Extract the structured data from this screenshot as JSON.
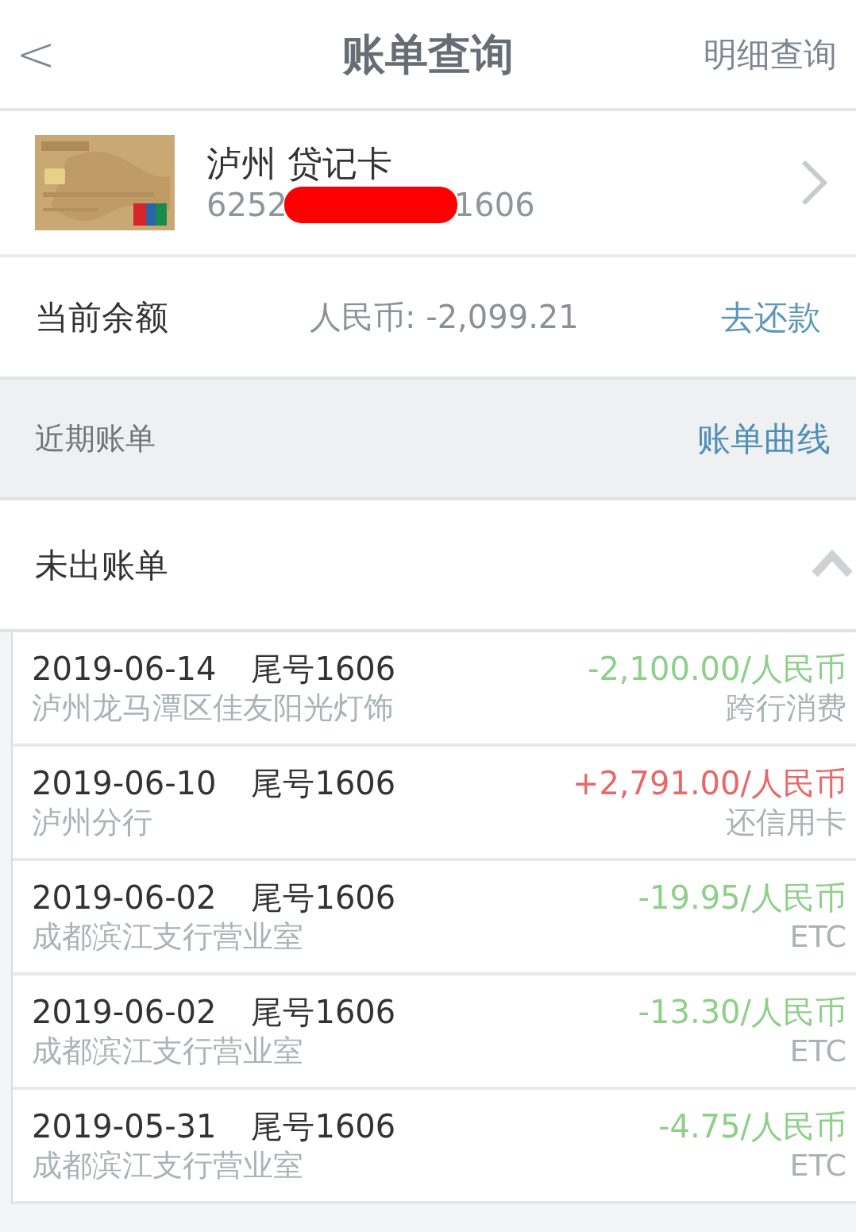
{
  "header": {
    "back": "<",
    "title": "账单查询",
    "action": "明细查询"
  },
  "card": {
    "name": "泸州 贷记卡",
    "number_start": "6252",
    "number_end": "1606"
  },
  "balance": {
    "label": "当前余额",
    "amount": "人民币: -2,099.21",
    "action": "去还款"
  },
  "section": {
    "title": "近期账单",
    "action": "账单曲线"
  },
  "unbilled": {
    "title": "未出账单",
    "expanded": true
  },
  "transactions": [
    {
      "date": "2019-06-14",
      "card_tail": "尾号1606",
      "merchant": "泸州龙马潭区佳友阳光灯饰",
      "amount": "-2,100.00/人民币",
      "type": "跨行消费",
      "kind": "debit"
    },
    {
      "date": "2019-06-10",
      "card_tail": "尾号1606",
      "merchant": "泸州分行",
      "amount": "+2,791.00/人民币",
      "type": "还信用卡",
      "kind": "credit"
    },
    {
      "date": "2019-06-02",
      "card_tail": "尾号1606",
      "merchant": "成都滨江支行营业室",
      "amount": "-19.95/人民币",
      "type": "ETC",
      "kind": "debit"
    },
    {
      "date": "2019-06-02",
      "card_tail": "尾号1606",
      "merchant": "成都滨江支行营业室",
      "amount": "-13.30/人民币",
      "type": "ETC",
      "kind": "debit"
    },
    {
      "date": "2019-05-31",
      "card_tail": "尾号1606",
      "merchant": "成都滨江支行营业室",
      "amount": "-4.75/人民币",
      "type": "ETC",
      "kind": "debit"
    }
  ]
}
